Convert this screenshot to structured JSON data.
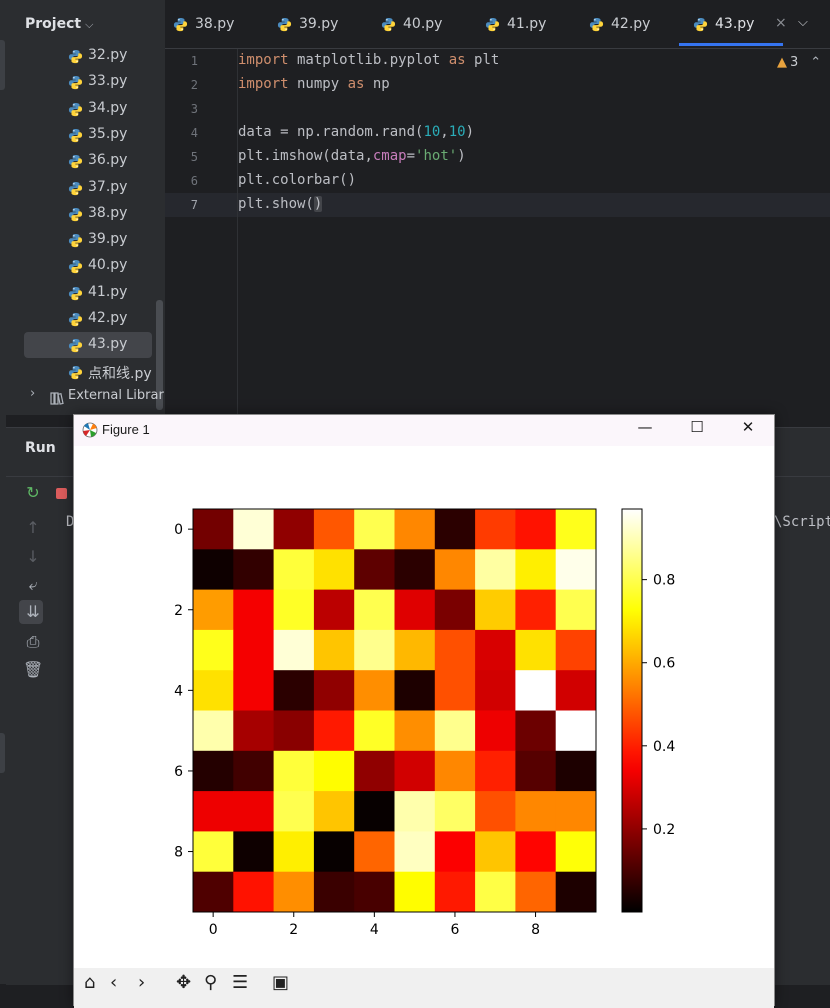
{
  "project_panel": {
    "title": "Project",
    "files": [
      "32.py",
      "33.py",
      "34.py",
      "35.py",
      "36.py",
      "37.py",
      "38.py",
      "39.py",
      "40.py",
      "41.py",
      "42.py",
      "43.py",
      "点和线.py"
    ],
    "selected_file": "43.py",
    "external_libraries_label": "External Librarie"
  },
  "tabs": [
    {
      "label": "38.py"
    },
    {
      "label": "39.py"
    },
    {
      "label": "40.py"
    },
    {
      "label": "41.py"
    },
    {
      "label": "42.py"
    },
    {
      "label": "43.py",
      "active": true
    }
  ],
  "editor": {
    "line_numbers": [
      "1",
      "2",
      "3",
      "4",
      "5",
      "6",
      "7"
    ],
    "current_line": "7",
    "warnings_count": "3",
    "code": {
      "l1_kw_import": "import",
      "l1_mod": " matplotlib.pyplot ",
      "l1_kw_as": "as",
      "l1_alias": " plt",
      "l2_kw_import": "import",
      "l2_mod": " numpy ",
      "l2_kw_as": "as",
      "l2_alias": " np",
      "l4_a": "data = np.random.rand(",
      "l4_n1": "10",
      "l4_comma": ",",
      "l4_n2": "10",
      "l4_close": ")",
      "l5_a": "plt.imshow(data",
      "l5_comma": ",",
      "l5_param": "cmap",
      "l5_eq": "=",
      "l5_str": "'hot'",
      "l5_close": ")",
      "l6": "plt.colorbar()",
      "l7_a": "plt.show(",
      "l7_b": ")"
    }
  },
  "run_panel": {
    "title": "Run",
    "console_prefix": "D",
    "console_path_fragment": "\\Script"
  },
  "figure_window": {
    "title": "Figure 1",
    "minimize_glyph": "—",
    "maximize_glyph": "☐",
    "close_glyph": "✕"
  },
  "chart_data": {
    "type": "heatmap",
    "colormap": "hot",
    "x_ticks": [
      "0",
      "2",
      "4",
      "6",
      "8"
    ],
    "y_ticks": [
      "0",
      "2",
      "4",
      "6",
      "8"
    ],
    "colorbar_ticks": [
      "0.2",
      "0.4",
      "0.6",
      "0.8"
    ],
    "colorbar_range": [
      0.0,
      0.97
    ],
    "values": [
      [
        0.16,
        0.93,
        0.2,
        0.48,
        0.8,
        0.55,
        0.06,
        0.44,
        0.38,
        0.75
      ],
      [
        0.02,
        0.07,
        0.78,
        0.68,
        0.13,
        0.06,
        0.55,
        0.88,
        0.7,
        0.95
      ],
      [
        0.58,
        0.34,
        0.76,
        0.26,
        0.8,
        0.31,
        0.17,
        0.65,
        0.4,
        0.8
      ],
      [
        0.75,
        0.34,
        0.93,
        0.64,
        0.86,
        0.62,
        0.47,
        0.3,
        0.68,
        0.45
      ],
      [
        0.68,
        0.34,
        0.06,
        0.2,
        0.56,
        0.04,
        0.47,
        0.29,
        0.97,
        0.29
      ],
      [
        0.89,
        0.23,
        0.19,
        0.39,
        0.76,
        0.56,
        0.86,
        0.33,
        0.15,
        0.97
      ],
      [
        0.05,
        0.09,
        0.78,
        0.72,
        0.2,
        0.29,
        0.55,
        0.4,
        0.12,
        0.04
      ],
      [
        0.33,
        0.33,
        0.8,
        0.64,
        0.01,
        0.89,
        0.82,
        0.47,
        0.55,
        0.55
      ],
      [
        0.78,
        0.02,
        0.7,
        0.01,
        0.5,
        0.91,
        0.35,
        0.64,
        0.36,
        0.73
      ],
      [
        0.11,
        0.38,
        0.56,
        0.08,
        0.1,
        0.72,
        0.39,
        0.79,
        0.5,
        0.04
      ]
    ]
  }
}
